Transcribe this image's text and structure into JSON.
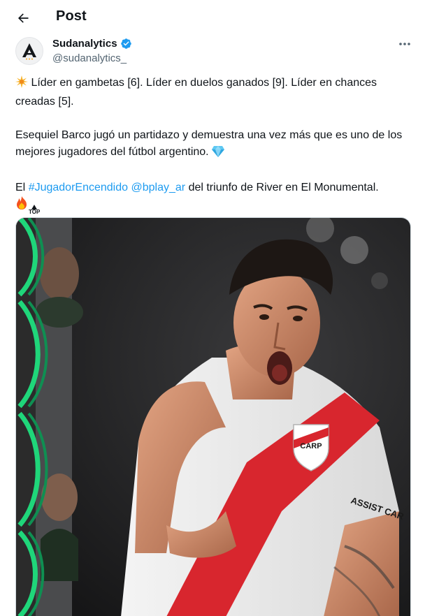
{
  "header": {
    "title": "Post"
  },
  "author": {
    "name": "Sudanalytics",
    "handle": "@sudanalytics_",
    "verified": true
  },
  "tweet": {
    "line1": "Líder en gambetas [6]. Líder en duelos ganados [9]. Líder en chances creadas [5].",
    "line2": "Esequiel Barco jugó un partidazo y demuestra una vez más que es uno de los mejores jugadores del fútbol argentino.",
    "line3_prefix": "El",
    "hashtag": "#JugadorEncendido",
    "mention": "@bplay_ar",
    "line3_suffix": "del triunfo de River en El Monumental.",
    "top_label": "TOP"
  },
  "media": {
    "jersey_text": "ASSIST CAR"
  },
  "colors": {
    "link": "#1d9bf0",
    "verified": "#1d9bf0",
    "accent_green": "#1fd67a",
    "jersey_red": "#d8262e"
  },
  "icons": {
    "back": "arrow-left-icon",
    "more": "more-icon",
    "verified": "verified-badge-icon",
    "sparkle": "sparkle-emoji",
    "diamond": "diamond-emoji",
    "fire": "fire-emoji"
  }
}
